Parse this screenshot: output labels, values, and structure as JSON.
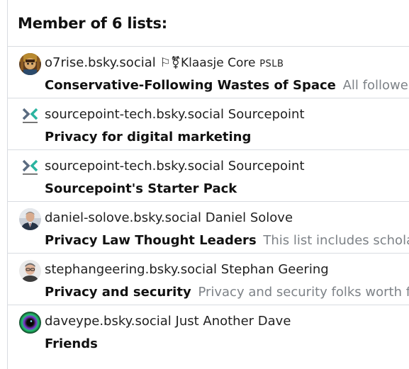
{
  "header": {
    "title": "Member of 6 lists:"
  },
  "lists": [
    {
      "handle": "o7rise.bsky.social",
      "display_name": "⚐⚧Klaasje Core",
      "display_suffix": "PSLB",
      "list_name": "Conservative-Following Wastes of Space",
      "description": "All followers",
      "avatar": "o7rise-avatar"
    },
    {
      "handle": "sourcepoint-tech.bsky.social",
      "display_name": "Sourcepoint",
      "display_suffix": "",
      "list_name": "Privacy for digital marketing",
      "description": "",
      "avatar": "sourcepoint-logo-avatar"
    },
    {
      "handle": "sourcepoint-tech.bsky.social",
      "display_name": "Sourcepoint",
      "display_suffix": "",
      "list_name": "Sourcepoint's Starter Pack",
      "description": "",
      "avatar": "sourcepoint-logo-avatar"
    },
    {
      "handle": "daniel-solove.bsky.social",
      "display_name": "Daniel Solove",
      "display_suffix": "",
      "list_name": "Privacy Law Thought Leaders",
      "description": "This list includes scholar",
      "avatar": "daniel-solove-avatar"
    },
    {
      "handle": "stephangeering.bsky.social",
      "display_name": "Stephan Geering",
      "display_suffix": "",
      "list_name": "Privacy and security",
      "description": "Privacy and security folks worth fo",
      "avatar": "stephan-geering-avatar"
    },
    {
      "handle": "daveype.bsky.social",
      "display_name": "Just Another Dave",
      "display_suffix": "",
      "list_name": "Friends",
      "description": "",
      "avatar": "daveype-avatar"
    }
  ],
  "colors": {
    "divider": "#d9dce1",
    "text_primary": "#111111",
    "text_secondary": "#7d8287"
  }
}
